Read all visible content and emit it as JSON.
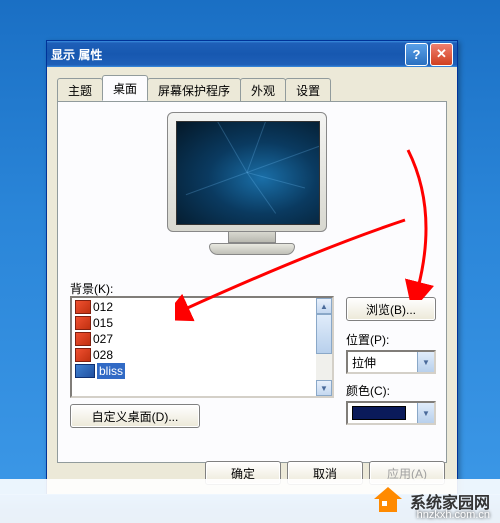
{
  "window": {
    "title": "显示 属性"
  },
  "tabs": [
    "主题",
    "桌面",
    "屏幕保护程序",
    "外观",
    "设置"
  ],
  "activeTab": 1,
  "bgSection": {
    "label": "背景(K):",
    "items": [
      "012",
      "015",
      "027",
      "028",
      "bliss"
    ],
    "selectedIndex": 4,
    "browse": "浏览(B)...",
    "positionLabel": "位置(P):",
    "positionValue": "拉伸",
    "colorLabel": "颜色(C):",
    "customize": "自定义桌面(D)..."
  },
  "buttons": {
    "ok": "确定",
    "cancel": "取消",
    "apply": "应用(A)"
  },
  "watermark": {
    "text": "系统家园网",
    "url": "hnzkxh.com.cn"
  }
}
